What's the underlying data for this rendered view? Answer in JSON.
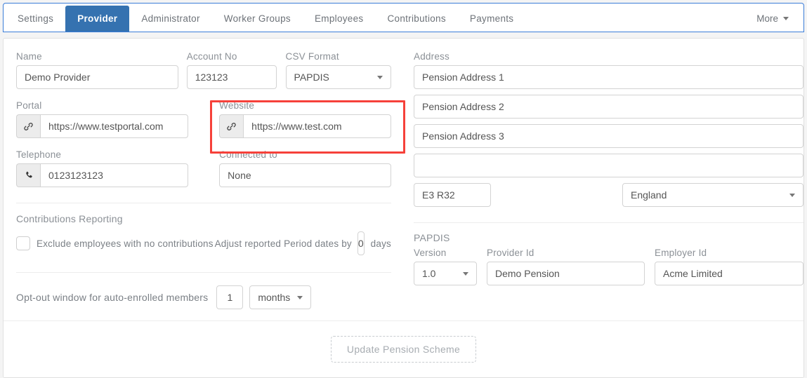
{
  "tabs": [
    {
      "label": "Settings",
      "active": false
    },
    {
      "label": "Provider",
      "active": true
    },
    {
      "label": "Administrator",
      "active": false
    },
    {
      "label": "Worker Groups",
      "active": false
    },
    {
      "label": "Employees",
      "active": false
    },
    {
      "label": "Contributions",
      "active": false
    },
    {
      "label": "Payments",
      "active": false
    }
  ],
  "more_label": "More",
  "left": {
    "name": {
      "label": "Name",
      "value": "Demo Provider"
    },
    "account_no": {
      "label": "Account No",
      "value": "123123"
    },
    "csv_format": {
      "label": "CSV Format",
      "value": "PAPDIS"
    },
    "portal": {
      "label": "Portal",
      "value": "https://www.testportal.com",
      "icon": "link-icon"
    },
    "website": {
      "label": "Website",
      "value": "https://www.test.com",
      "icon": "link-icon"
    },
    "telephone": {
      "label": "Telephone",
      "value": "0123123123",
      "icon": "phone-icon"
    },
    "connected_to": {
      "label": "Connected to",
      "value": "None"
    },
    "contributions_reporting": {
      "heading": "Contributions Reporting",
      "exclude_label": "Exclude employees with no contributions",
      "exclude_checked": false,
      "adjust_label": "Adjust reported Period dates by",
      "adjust_value": "0",
      "adjust_suffix": "days"
    },
    "optout": {
      "label": "Opt-out window for auto-enrolled members",
      "value": "1",
      "unit": "months"
    }
  },
  "right": {
    "address": {
      "label": "Address",
      "lines": [
        "Pension Address 1",
        "Pension Address 2",
        "Pension Address 3",
        ""
      ],
      "postcode": "E3 R32",
      "country": "England"
    },
    "papdis": {
      "heading": "PAPDIS",
      "version_label": "Version",
      "version_value": "1.0",
      "provider_id_label": "Provider Id",
      "provider_id_value": "Demo Pension",
      "employer_id_label": "Employer Id",
      "employer_id_value": "Acme Limited"
    }
  },
  "footer": {
    "update_button": "Update Pension Scheme",
    "update_disabled": true
  },
  "annotation": {
    "highlight_color": "#f6413a",
    "highlight_target": "website-field-group"
  },
  "colors": {
    "active_tab": "#3572b0",
    "tabbar_border": "#3b7dd8",
    "page_bg": "#f4f4f4",
    "panel_bg": "#ffffff"
  }
}
